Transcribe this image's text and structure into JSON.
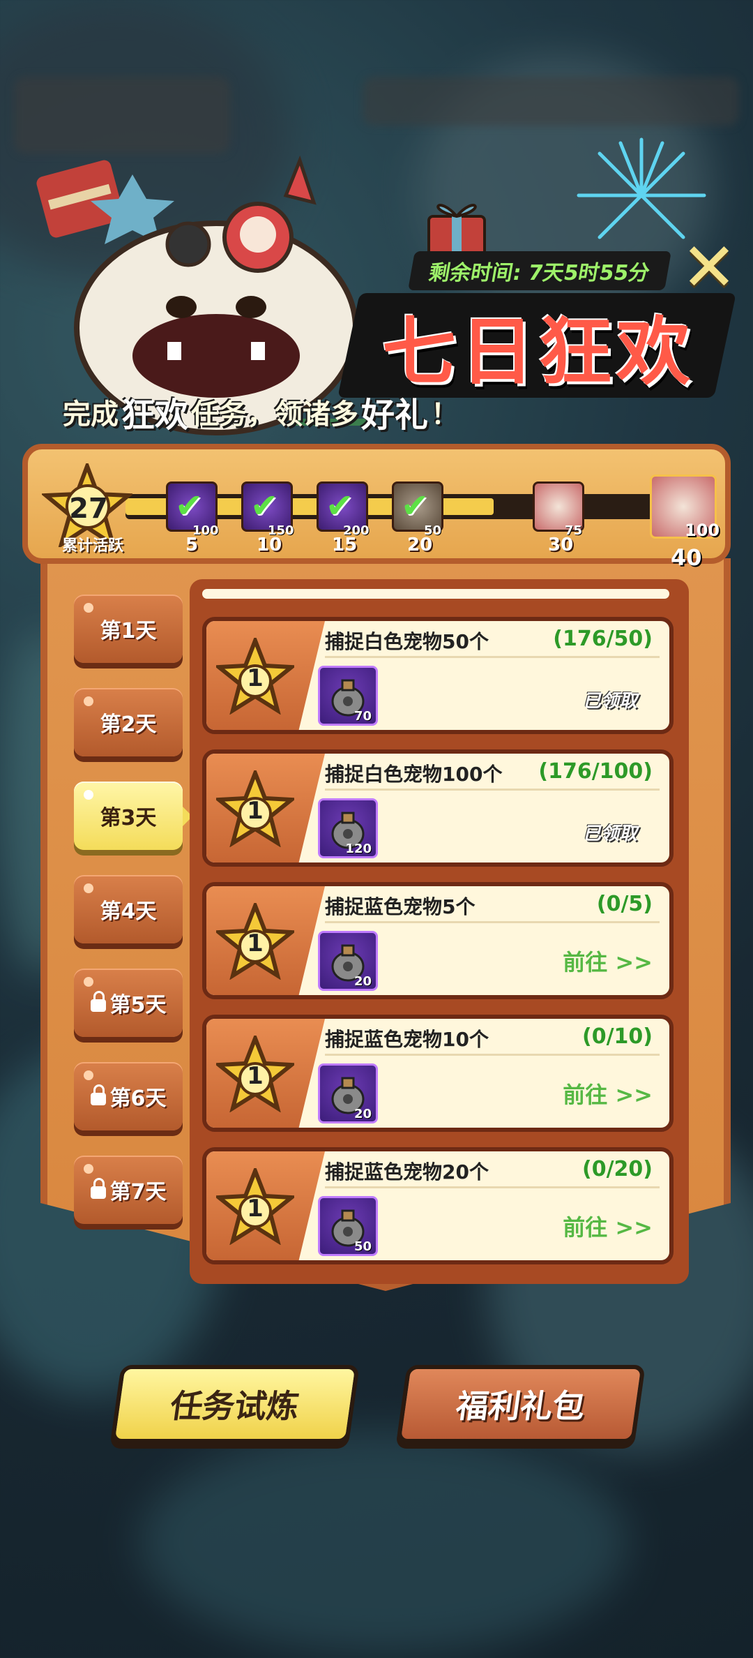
{
  "event": {
    "timer_label": "剩余时间: 7天5时55分",
    "title": "七日狂欢",
    "subtitle_parts": [
      "完成",
      "狂欢",
      "任务，领诸多",
      "好礼",
      "！"
    ]
  },
  "activity": {
    "value": "27",
    "label": "累计活跃",
    "progress_fraction": 0.66,
    "milestones": [
      {
        "threshold": "5",
        "count": "100",
        "claimed": true
      },
      {
        "threshold": "10",
        "count": "150",
        "claimed": true
      },
      {
        "threshold": "15",
        "count": "200",
        "claimed": true
      },
      {
        "threshold": "20",
        "count": "50",
        "claimed": true
      },
      {
        "threshold": "30",
        "count": "75",
        "claimed": false
      },
      {
        "threshold": "",
        "count": "100",
        "claimed": false
      }
    ],
    "final_count": "40"
  },
  "days": [
    {
      "label": "第1天",
      "locked": false,
      "active": false
    },
    {
      "label": "第2天",
      "locked": false,
      "active": false
    },
    {
      "label": "第3天",
      "locked": false,
      "active": true
    },
    {
      "label": "第4天",
      "locked": false,
      "active": false
    },
    {
      "label": "第5天",
      "locked": true,
      "active": false
    },
    {
      "label": "第6天",
      "locked": true,
      "active": false
    },
    {
      "label": "第7天",
      "locked": true,
      "active": false
    }
  ],
  "tasks": [
    {
      "star": "1",
      "title": "捕捉白色宠物50个",
      "progress": "(176/50)",
      "reward_count": "70",
      "status": "已领取",
      "claimed": true
    },
    {
      "star": "1",
      "title": "捕捉白色宠物100个",
      "progress": "(176/100)",
      "reward_count": "120",
      "status": "已领取",
      "claimed": true
    },
    {
      "star": "1",
      "title": "捕捉蓝色宠物5个",
      "progress": "(0/5)",
      "reward_count": "20",
      "status": "前往 >>",
      "claimed": false
    },
    {
      "star": "1",
      "title": "捕捉蓝色宠物10个",
      "progress": "(0/10)",
      "reward_count": "20",
      "status": "前往 >>",
      "claimed": false
    },
    {
      "star": "1",
      "title": "捕捉蓝色宠物20个",
      "progress": "(0/20)",
      "reward_count": "50",
      "status": "前往 >>",
      "claimed": false
    }
  ],
  "buttons": {
    "primary": "任务试炼",
    "secondary": "福利礼包"
  },
  "colors": {
    "accent_yellow": "#f4dc5a",
    "board_orange": "#d9873f",
    "progress_green": "#2d9a28",
    "title_red": "#ff5a48",
    "timer_green": "#9ef26a"
  }
}
